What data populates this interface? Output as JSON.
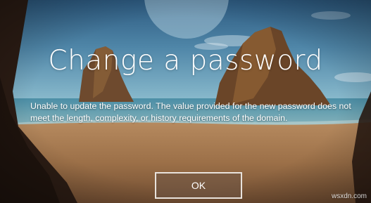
{
  "dialog": {
    "title": "Change a password",
    "message": "Unable to update the password. The value provided for the new password does not meet the length, complexity, or history requirements of the domain.",
    "ok_label": "OK"
  },
  "watermark": "wsxdn.com",
  "colors": {
    "text": "#ffffff",
    "button_border": "#e8e2dc",
    "button_fill": "#6e5646",
    "sky_top": "#2f5f86",
    "sea": "#5f9aae",
    "sand": "#a77a52"
  }
}
